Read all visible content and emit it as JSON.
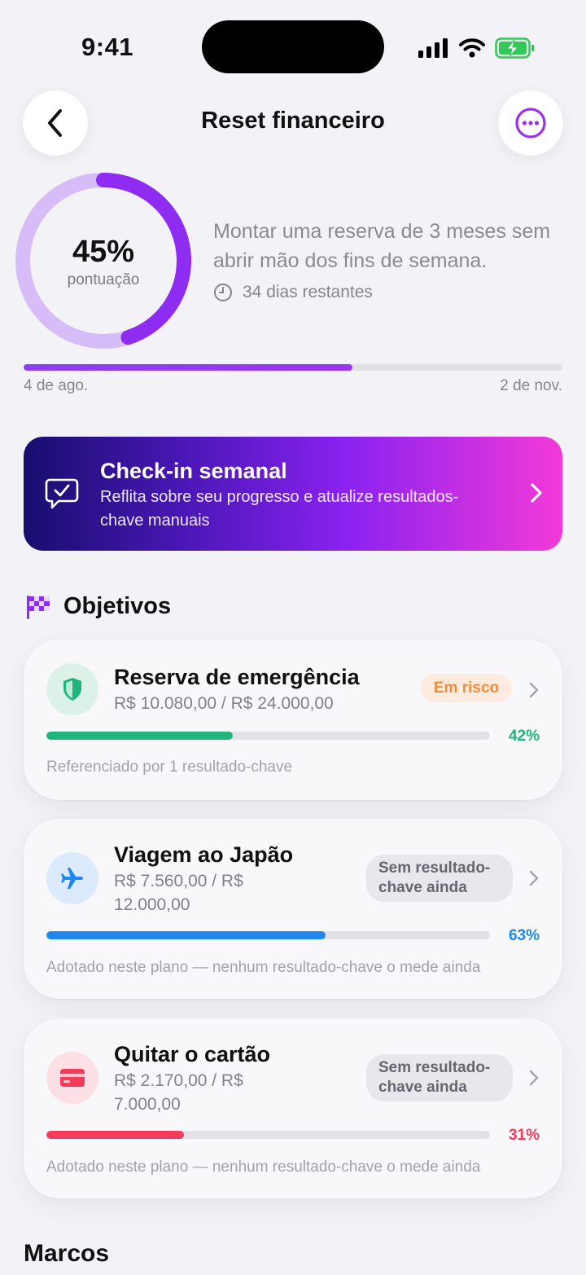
{
  "status_bar": {
    "time": "9:41"
  },
  "header": {
    "title": "Reset financeiro",
    "back_icon": "chevron-left-icon",
    "more_icon": "ellipsis-icon",
    "accent": "#9b30f0"
  },
  "score": {
    "value": "45%",
    "label": "pontuação",
    "fraction": 0.45
  },
  "goal": {
    "description": "Montar uma reserva de 3 meses sem abrir mão dos fins de semana.",
    "days_left": "34 dias restantes"
  },
  "timeline": {
    "start": "4 de ago.",
    "end": "2 de nov.",
    "progress": 0.61
  },
  "checkin": {
    "title": "Check-in semanal",
    "subtitle": "Reflita sobre seu progresso e atualize resultados-chave manuais",
    "icon": "chat-check-icon"
  },
  "objectives": {
    "title": "Objetivos",
    "icon": "checkered-flag-icon",
    "items": [
      {
        "title": "Reserva de emergência",
        "amount": "R$ 10.080,00 / R$ 24.000,00",
        "badge": "Em risco",
        "percent": "42%",
        "progress": 0.42,
        "color": "#1fb57c",
        "icon": "shield-icon",
        "note": "Referenciado por 1 resultado-chave"
      },
      {
        "title": "Viagem ao Japão",
        "amount": "R$ 7.560,00 / R$ 12.000,00",
        "badge": "Sem resultado-chave ainda",
        "percent": "63%",
        "progress": 0.63,
        "color": "#1f88ec",
        "icon": "airplane-icon",
        "note": "Adotado neste plano — nenhum resultado-chave o mede ainda"
      },
      {
        "title": "Quitar o cartão",
        "amount": "R$ 2.170,00 / R$ 7.000,00",
        "badge": "Sem resultado-chave ainda",
        "percent": "31%",
        "progress": 0.31,
        "color": "#f33b5c",
        "icon": "credit-card-icon",
        "note": "Adotado neste plano — nenhum resultado-chave o mede ainda"
      }
    ]
  },
  "milestones": {
    "title": "Marcos"
  }
}
